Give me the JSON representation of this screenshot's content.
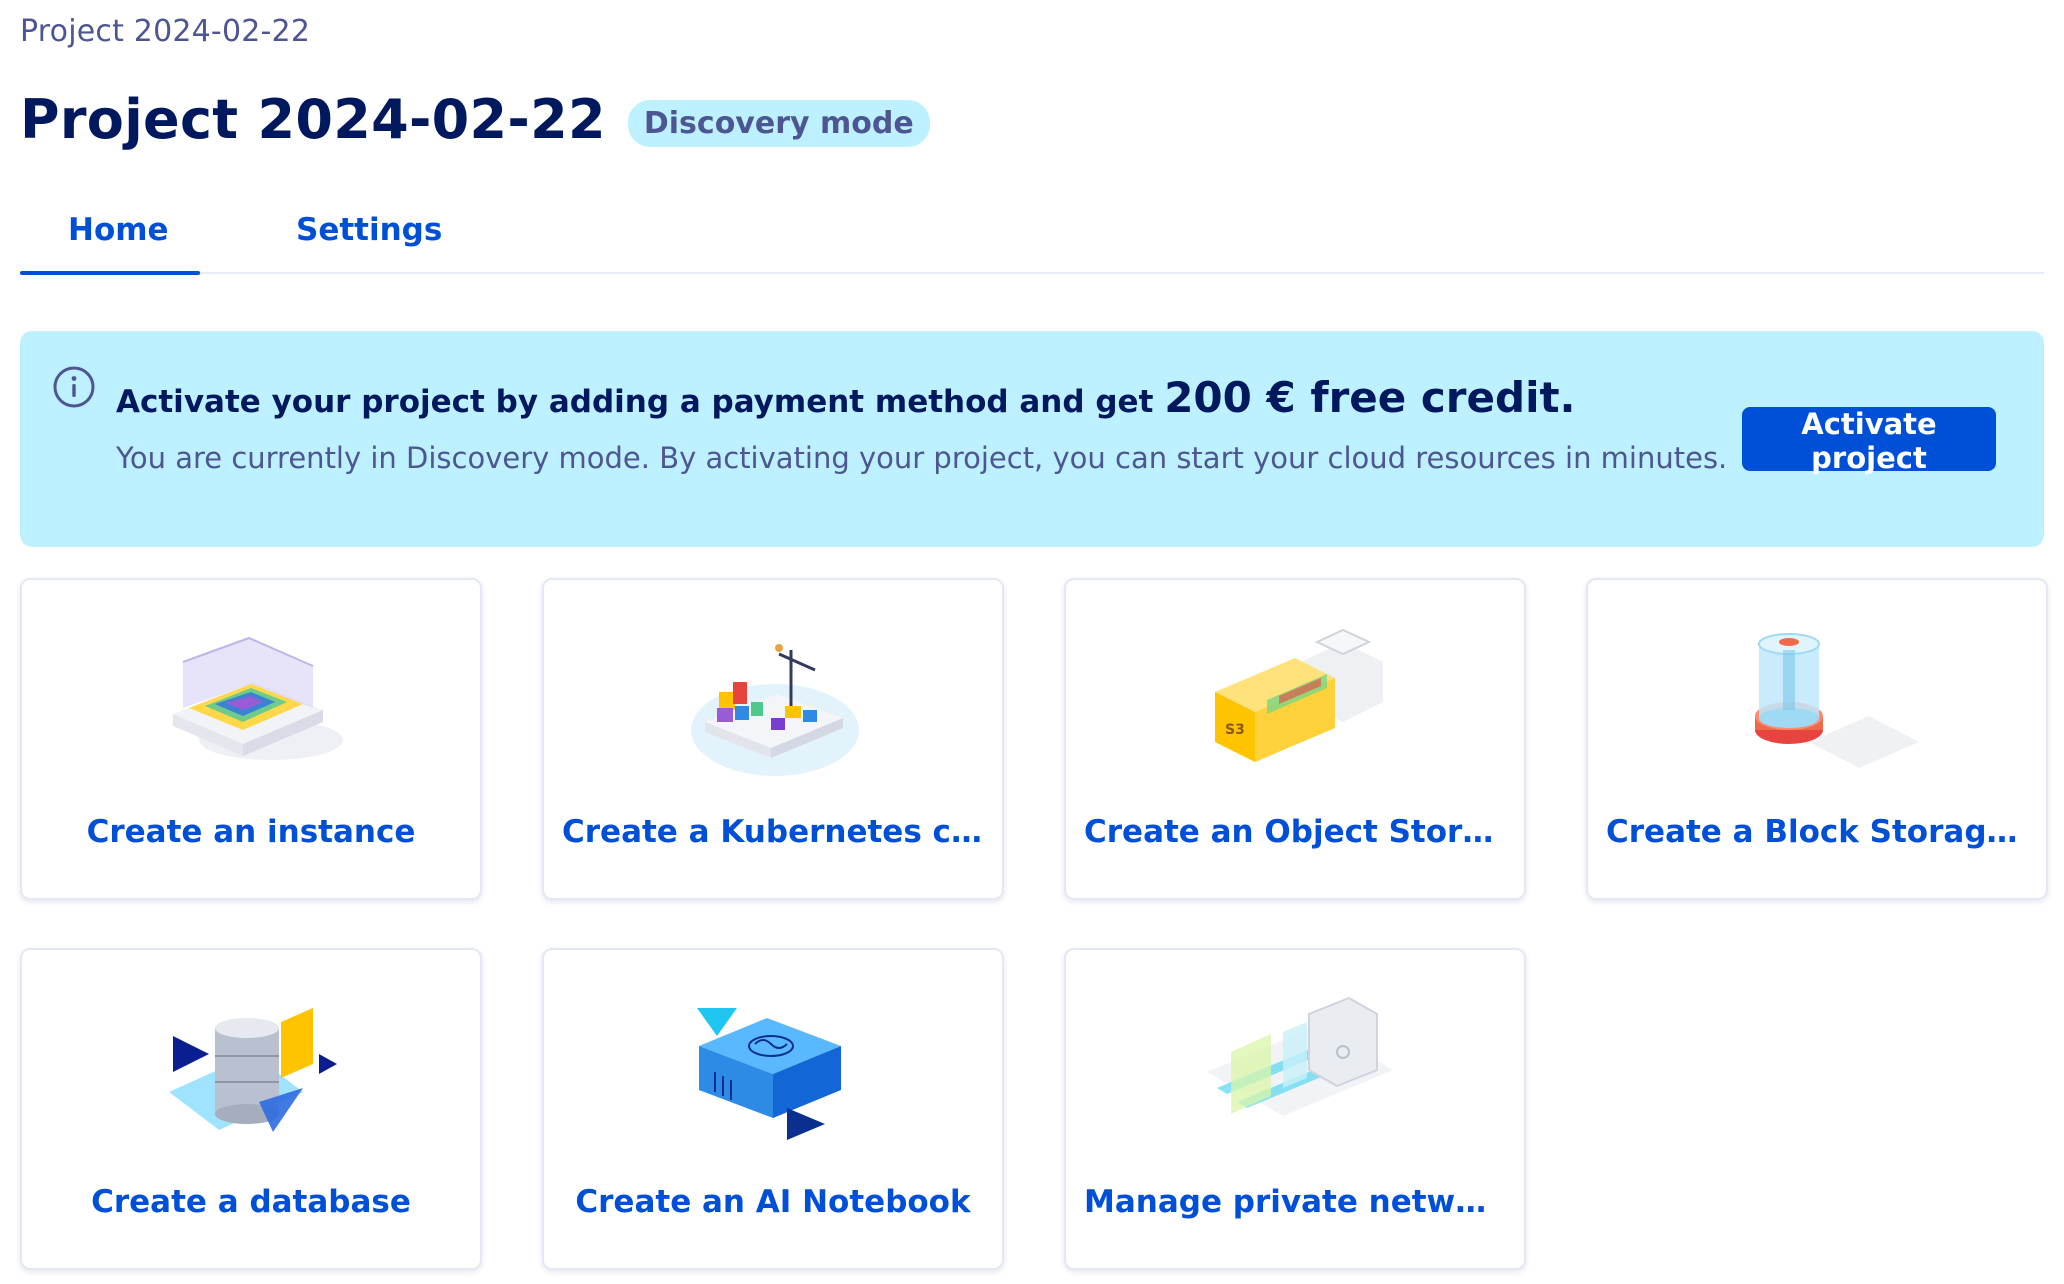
{
  "breadcrumb": "Project 2024-02-22",
  "page_title": "Project 2024-02-22",
  "mode_badge": "Discovery mode",
  "tabs": [
    {
      "label": "Home",
      "active": true
    },
    {
      "label": "Settings",
      "active": false
    }
  ],
  "banner": {
    "icon": "info-icon",
    "headline_prefix": "Activate your project by adding a payment method and get ",
    "headline_highlight": "200 € free credit.",
    "subtext": "You are currently in Discovery mode. By activating your project, you can start your cloud resources in minutes.",
    "button_label": "Activate project"
  },
  "cards": [
    {
      "label": "Create an instance",
      "icon": "instance-illustration-icon"
    },
    {
      "label": "Create a Kubernetes cluster",
      "icon": "kubernetes-illustration-icon"
    },
    {
      "label": "Create an Object Storage …",
      "icon": "object-storage-illustration-icon"
    },
    {
      "label": "Create a Block Storage vol…",
      "icon": "block-storage-illustration-icon"
    },
    {
      "label": "Create a database",
      "icon": "database-illustration-icon"
    },
    {
      "label": "Create an AI Notebook",
      "icon": "ai-notebook-illustration-icon"
    },
    {
      "label": "Manage private networks …",
      "icon": "private-network-illustration-icon"
    }
  ],
  "colors": {
    "primary": "#0050d7",
    "title": "#00185e",
    "muted": "#4d5693",
    "banner_bg": "#bef1ff"
  }
}
